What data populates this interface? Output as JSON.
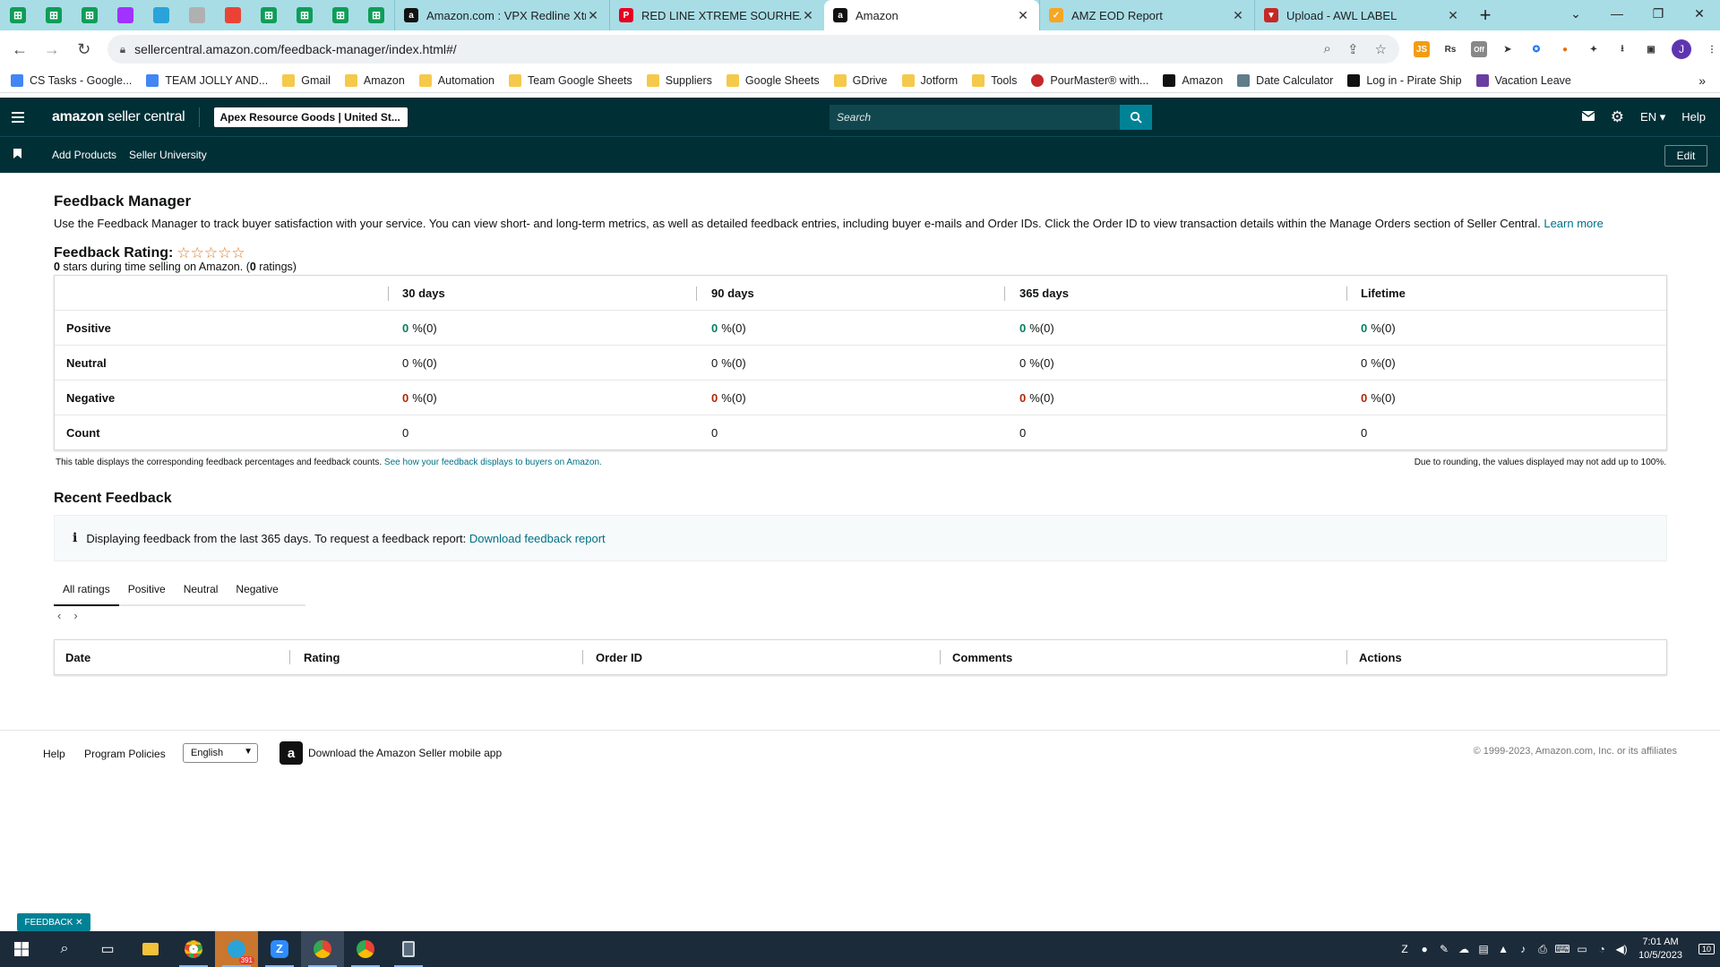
{
  "browser": {
    "pinned_tabs": [
      {
        "icon": "google-sheets-icon",
        "color": "#0f9d58"
      },
      {
        "icon": "google-sheets-icon",
        "color": "#0f9d58"
      },
      {
        "icon": "google-sheets-icon",
        "color": "#0f9d58"
      },
      {
        "icon": "messenger-icon",
        "color": "#a033ff"
      },
      {
        "icon": "telegram-icon",
        "color": "#2aa3d9"
      },
      {
        "icon": "signature-icon",
        "color": "#b0b0b0"
      },
      {
        "icon": "gmail-icon",
        "color": "#ea4335"
      },
      {
        "icon": "google-sheets-icon",
        "color": "#0f9d58"
      },
      {
        "icon": "google-sheets-icon",
        "color": "#0f9d58"
      },
      {
        "icon": "google-sheets-icon",
        "color": "#0f9d58"
      },
      {
        "icon": "google-sheets-icon",
        "color": "#0f9d58"
      }
    ],
    "tabs": [
      {
        "title": "Amazon.com : VPX Redline Xtreme",
        "icon": "amazon-icon",
        "active": false
      },
      {
        "title": "RED LINE XTREME SOURHEAD -",
        "icon": "pinterest-icon",
        "active": false
      },
      {
        "title": "Amazon",
        "icon": "amazon-icon",
        "active": true
      },
      {
        "title": "AMZ EOD Report",
        "icon": "report-icon",
        "active": false
      },
      {
        "title": "Upload - AWL LABEL",
        "icon": "awl-icon",
        "active": false
      }
    ],
    "url": "sellercentral.amazon.com/feedback-manager/index.html#/",
    "bookmarks": [
      {
        "label": "CS Tasks - Google...",
        "type": "docs"
      },
      {
        "label": "TEAM JOLLY AND...",
        "type": "docs"
      },
      {
        "label": "Gmail",
        "type": "folder"
      },
      {
        "label": "Amazon",
        "type": "folder"
      },
      {
        "label": "Automation",
        "type": "folder"
      },
      {
        "label": "Team Google Sheets",
        "type": "folder"
      },
      {
        "label": "Suppliers",
        "type": "folder"
      },
      {
        "label": "Google Sheets",
        "type": "folder"
      },
      {
        "label": "GDrive",
        "type": "folder"
      },
      {
        "label": "Jotform",
        "type": "folder"
      },
      {
        "label": "Tools",
        "type": "folder"
      },
      {
        "label": "PourMaster® with...",
        "type": "site"
      },
      {
        "label": "Amazon",
        "type": "amazon"
      },
      {
        "label": "Date Calculator",
        "type": "calc"
      },
      {
        "label": "Log in - Pirate Ship",
        "type": "pirate"
      },
      {
        "label": "Vacation Leave",
        "type": "purple"
      }
    ],
    "profile_initial": "J"
  },
  "header": {
    "logo_main": "amazon",
    "logo_sub": " seller central",
    "account": "Apex Resource Goods | United St...",
    "search_placeholder": "Search",
    "language": "EN ▾",
    "help": "Help"
  },
  "nav": {
    "items": [
      "Add Products",
      "Seller University"
    ],
    "edit": "Edit"
  },
  "page": {
    "title": "Feedback Manager",
    "intro": "Use the Feedback Manager to track buyer satisfaction with your service. You can view short- and long-term metrics, as well as detailed feedback entries, including buyer e-mails and Order IDs. Click the Order ID to view transaction details within the Manage Orders section of Seller Central.",
    "learn_more": "Learn more",
    "rating_label": "Feedback Rating:",
    "stars": "☆☆☆☆☆",
    "stars_count": "0",
    "stars_text": " stars during time selling on Amazon. (",
    "ratings_count": "0",
    "ratings_text": " ratings)"
  },
  "metrics": {
    "columns": [
      "30 days",
      "90 days",
      "365 days",
      "Lifetime"
    ],
    "rows": [
      {
        "label": "Positive",
        "tone": "g",
        "values": [
          {
            "pct": "0",
            "rest": "%(0)"
          },
          {
            "pct": "0",
            "rest": "%(0)"
          },
          {
            "pct": "0",
            "rest": "%(0)"
          },
          {
            "pct": "0",
            "rest": "%(0)"
          }
        ]
      },
      {
        "label": "Neutral",
        "tone": "n",
        "values": [
          {
            "pct": "0",
            "rest": "%(0)"
          },
          {
            "pct": "0",
            "rest": "%(0)"
          },
          {
            "pct": "0",
            "rest": "%(0)"
          },
          {
            "pct": "0",
            "rest": "%(0)"
          }
        ]
      },
      {
        "label": "Negative",
        "tone": "r",
        "values": [
          {
            "pct": "0",
            "rest": "%(0)"
          },
          {
            "pct": "0",
            "rest": "%(0)"
          },
          {
            "pct": "0",
            "rest": "%(0)"
          },
          {
            "pct": "0",
            "rest": "%(0)"
          }
        ]
      },
      {
        "label": "Count",
        "tone": "c",
        "values": [
          {
            "pct": "",
            "rest": "0"
          },
          {
            "pct": "",
            "rest": "0"
          },
          {
            "pct": "",
            "rest": "0"
          },
          {
            "pct": "",
            "rest": "0"
          }
        ]
      }
    ],
    "note_left": "This table displays the corresponding feedback percentages and feedback counts.",
    "note_link": "See how your feedback displays to buyers on Amazon.",
    "note_right": "Due to rounding, the values displayed may not add up to 100%."
  },
  "recent": {
    "title": "Recent Feedback",
    "info_text": "Displaying feedback from the last 365 days. To request a feedback report:",
    "info_link": "Download feedback report",
    "tabs": [
      "All ratings",
      "Positive",
      "Neutral",
      "Negative"
    ],
    "active_tab": 0,
    "columns": [
      "Date",
      "Rating",
      "Order ID",
      "Comments",
      "Actions"
    ]
  },
  "footer": {
    "help": "Help",
    "policies": "Program Policies",
    "language": "English",
    "app_text": "Download the Amazon Seller mobile app",
    "copyright": "© 1999-2023, Amazon.com, Inc. or its affiliates",
    "feedback_pill": "FEEDBACK ✕"
  },
  "taskbar": {
    "time": "7:01 AM",
    "date": "10/5/2023",
    "telegram_badge": "391",
    "notification_count": "10"
  }
}
